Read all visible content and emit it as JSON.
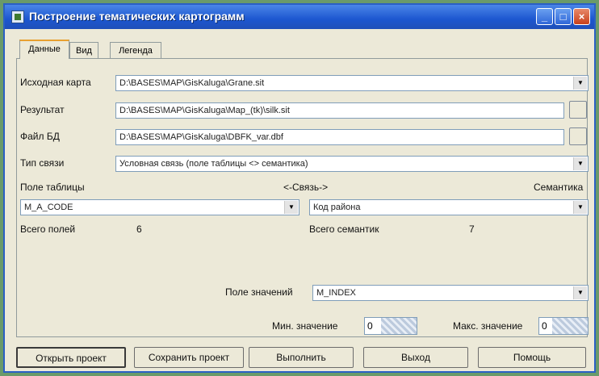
{
  "window": {
    "title": "Построение тематических картограмм",
    "controls": [
      "_",
      "□",
      "×"
    ]
  },
  "tabs": [
    {
      "label": "Данные",
      "active": true
    },
    {
      "label": "Вид",
      "active": false
    },
    {
      "label": "Легенда",
      "active": false
    }
  ],
  "form": {
    "source_map": {
      "label": "Исходная карта",
      "value": "D:\\BASES\\MAP\\GisKaluga\\Grane.sit"
    },
    "result": {
      "label": "Результат",
      "value": "D:\\BASES\\MAP\\GisKaluga\\Map_(tk)\\silk.sit"
    },
    "db_file": {
      "label": "Файл БД",
      "value": "D:\\BASES\\MAP\\GisKaluga\\DBFK_var.dbf"
    },
    "link_type": {
      "label": "Тип связи",
      "value": "Условная связь (поле таблицы <> семантика)"
    },
    "table_field_label": "Поле таблицы",
    "link_label": "<-Связь->",
    "semantics_label": "Семантика",
    "table_field_value": "M_A_CODE",
    "semantics_value": "Код района",
    "total_fields_label": "Всего полей",
    "total_fields_value": "6",
    "total_semantics_label": "Всего семантик",
    "total_semantics_value": "7",
    "value_field": {
      "label": "Поле значений",
      "value": "M_INDEX"
    },
    "min_value": {
      "label": "Мин. значение",
      "value": "0"
    },
    "max_value": {
      "label": "Макс. значение",
      "value": "0"
    }
  },
  "buttons": {
    "open_project": "Открыть проект",
    "save_project": "Сохранить проект",
    "run": "Выполнить",
    "exit": "Выход",
    "help": "Помощь"
  }
}
